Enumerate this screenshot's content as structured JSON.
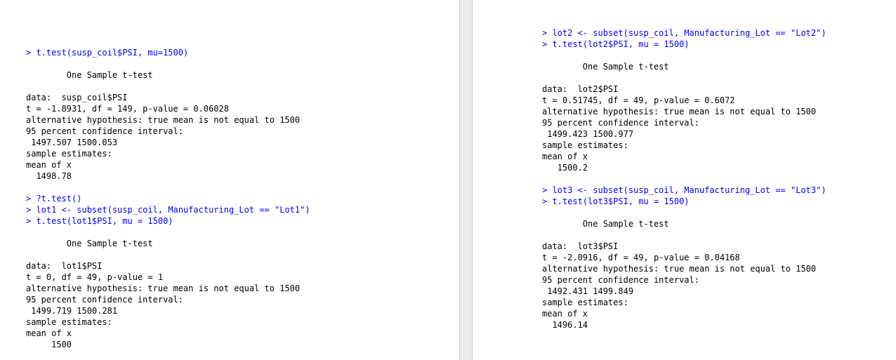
{
  "left_console": [
    {
      "text": "> t.test(susp_coil$PSI, mu=1500)",
      "kind": "cmd"
    },
    {
      "text": "        One Sample t-test",
      "kind": "out"
    },
    {
      "text": "data:  susp_coil$PSI",
      "kind": "out"
    },
    {
      "text": "t = -1.8931, df = 149, p-value = 0.06028",
      "kind": "out"
    },
    {
      "text": "alternative hypothesis: true mean is not equal to 1500",
      "kind": "out"
    },
    {
      "text": "95 percent confidence interval:",
      "kind": "out"
    },
    {
      "text": " 1497.507 1500.053",
      "kind": "out"
    },
    {
      "text": "sample estimates:",
      "kind": "out"
    },
    {
      "text": "mean of x",
      "kind": "out"
    },
    {
      "text": "  1498.78",
      "kind": "out"
    },
    {
      "text": "> ?t.test()",
      "kind": "cmd"
    },
    {
      "text": "> lot1 <- subset(susp_coil, Manufacturing_Lot == \"Lot1\")",
      "kind": "cmd"
    },
    {
      "text": "> t.test(lot1$PSI, mu = 1500)",
      "kind": "cmd"
    },
    {
      "text": "        One Sample t-test",
      "kind": "out"
    },
    {
      "text": "data:  lot1$PSI",
      "kind": "out"
    },
    {
      "text": "t = 0, df = 49, p-value = 1",
      "kind": "out"
    },
    {
      "text": "alternative hypothesis: true mean is not equal to 1500",
      "kind": "out"
    },
    {
      "text": "95 percent confidence interval:",
      "kind": "out"
    },
    {
      "text": " 1499.719 1500.281",
      "kind": "out"
    },
    {
      "text": "sample estimates:",
      "kind": "out"
    },
    {
      "text": "mean of x",
      "kind": "out"
    },
    {
      "text": "     1500",
      "kind": "out"
    }
  ],
  "right_console": [
    {
      "text": "> lot2 <- subset(susp_coil, Manufacturing_Lot == \"Lot2\")",
      "kind": "cmd"
    },
    {
      "text": "> t.test(lot2$PSI, mu = 1500)",
      "kind": "cmd"
    },
    {
      "text": "        One Sample t-test",
      "kind": "out"
    },
    {
      "text": "data:  lot2$PSI",
      "kind": "out"
    },
    {
      "text": "t = 0.51745, df = 49, p-value = 0.6072",
      "kind": "out"
    },
    {
      "text": "alternative hypothesis: true mean is not equal to 1500",
      "kind": "out"
    },
    {
      "text": "95 percent confidence interval:",
      "kind": "out"
    },
    {
      "text": " 1499.423 1500.977",
      "kind": "out"
    },
    {
      "text": "sample estimates:",
      "kind": "out"
    },
    {
      "text": "mean of x",
      "kind": "out"
    },
    {
      "text": "   1500.2",
      "kind": "out"
    },
    {
      "text": "> lot3 <- subset(susp_coil, Manufacturing_Lot == \"Lot3\")",
      "kind": "cmd"
    },
    {
      "text": "> t.test(lot3$PSI, mu = 1500)",
      "kind": "cmd"
    },
    {
      "text": "        One Sample t-test",
      "kind": "out"
    },
    {
      "text": "data:  lot3$PSI",
      "kind": "out"
    },
    {
      "text": "t = -2.0916, df = 49, p-value = 0.04168",
      "kind": "out"
    },
    {
      "text": "alternative hypothesis: true mean is not equal to 1500",
      "kind": "out"
    },
    {
      "text": "95 percent confidence interval:",
      "kind": "out"
    },
    {
      "text": " 1492.431 1499.849",
      "kind": "out"
    },
    {
      "text": "sample estimates:",
      "kind": "out"
    },
    {
      "text": "mean of x",
      "kind": "out"
    },
    {
      "text": "  1496.14",
      "kind": "out"
    }
  ],
  "colors": {
    "command": "#0000ff",
    "output": "#000000",
    "splitter": "#ececec"
  }
}
